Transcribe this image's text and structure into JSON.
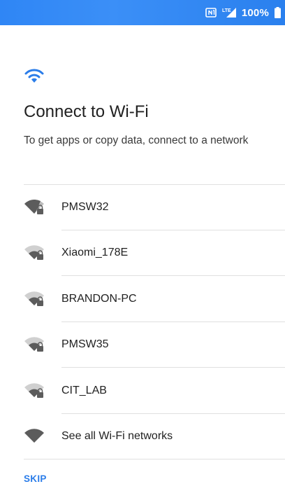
{
  "status_bar": {
    "battery_percent": "100%",
    "network_type": "LTE",
    "bg_color": "#3b8ff7",
    "icons": [
      "nfc-icon",
      "lte-signal-icon",
      "battery-icon"
    ]
  },
  "header": {
    "icon": "wifi-icon",
    "accent_color": "#2b7de9",
    "title": "Connect to Wi-Fi",
    "subtitle": "To get apps or copy data, connect to a network"
  },
  "networks": [
    {
      "name": "PMSW32",
      "secured": true,
      "strength": 0.75
    },
    {
      "name": "Xiaomi_178E",
      "secured": true,
      "strength": 0.5
    },
    {
      "name": "BRANDON-PC",
      "secured": true,
      "strength": 0.5
    },
    {
      "name": "PMSW35",
      "secured": true,
      "strength": 0.5
    },
    {
      "name": "CIT_LAB",
      "secured": true,
      "strength": 0.5
    }
  ],
  "see_all": {
    "label": "See all Wi-Fi networks",
    "icon": "wifi-full-icon"
  },
  "skip_label": "SKIP"
}
